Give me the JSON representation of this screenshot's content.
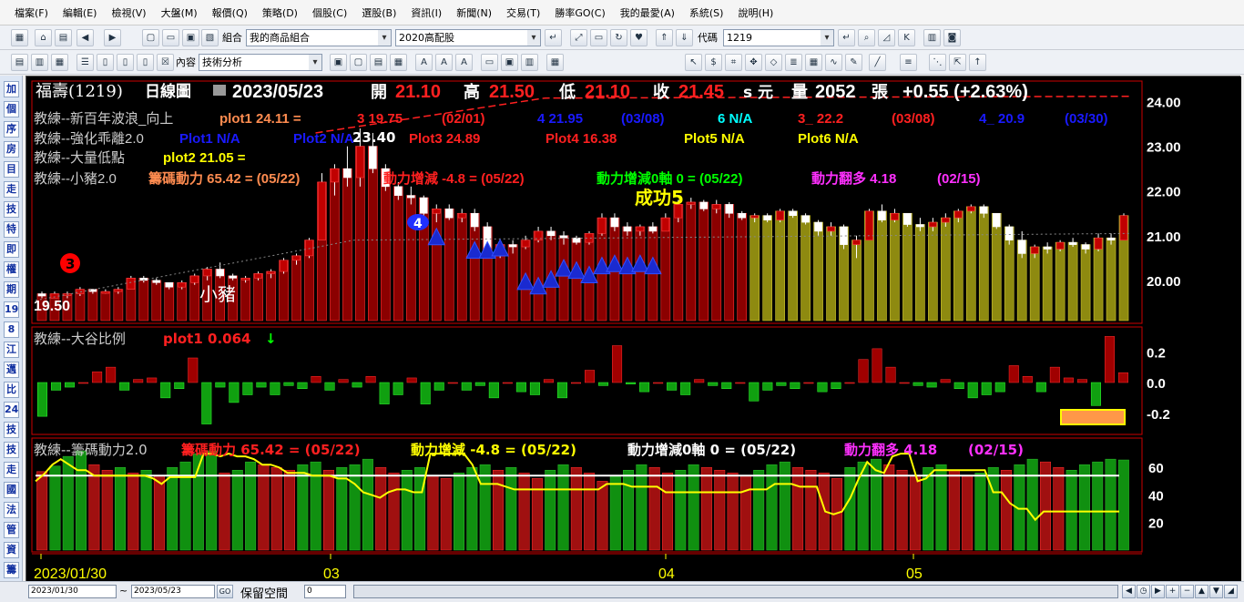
{
  "menu": [
    "檔案(F)",
    "編輯(E)",
    "檢視(V)",
    "大盤(M)",
    "報價(Q)",
    "策略(D)",
    "個股(C)",
    "選股(B)",
    "資訊(I)",
    "新聞(N)",
    "交易(T)",
    "勝率GO(C)",
    "我的最愛(A)",
    "系統(S)",
    "說明(H)"
  ],
  "toolbar1": {
    "group_label": "組合",
    "group_value": "我的商品組合",
    "preset_value": "2020高配股",
    "code_label": "代碼",
    "code_value": "1219"
  },
  "toolbar2": {
    "content_label": "內容",
    "content_value": "技術分析"
  },
  "sidebar": [
    "加",
    "個",
    "序",
    "房",
    "目",
    "走",
    "技",
    "特",
    "即",
    "權",
    "期",
    "19",
    "8",
    "江",
    "邁",
    "比",
    "24",
    "技",
    "技",
    "走",
    "國",
    "法",
    "管",
    "資",
    "籌"
  ],
  "header": {
    "name": "福壽(1219)",
    "period": "日線圖",
    "date": "2023/05/23",
    "open_label": "開",
    "open": "21.10",
    "high_label": "高",
    "high": "21.50",
    "low_label": "低",
    "low": "21.10",
    "close_label": "收",
    "close": "21.45",
    "unit": "s 元",
    "vol_label": "量",
    "vol": "2052",
    "vol_unit": "張",
    "change": "+0.55 (+2.63%)"
  },
  "colors": {
    "red": "#ff2020",
    "yellow": "#ffff00",
    "blue": "#1a1aff",
    "green": "#00ff00",
    "magenta": "#ff30ff",
    "orange": "#ff8c50",
    "white": "#ffffff",
    "cyan": "#00ffff",
    "candle_red": "#8b0000",
    "candle_olive": "#8e8a10",
    "bar_green": "#109010"
  },
  "panel1": {
    "line1": {
      "name": "教練--新百年波浪_向上",
      "p1": "plot1 24.11 =",
      "p2": "3 19.75",
      "p3": "(02/01)",
      "p4": "4 21.95",
      "p5": "(03/08)",
      "p6": "6 N/A",
      "p7": "3_ 22.2",
      "p8": "(03/08)",
      "p9": "4_ 20.9",
      "p10": "(03/30)"
    },
    "line2": {
      "name": "教練--強化乖離2.0",
      "p1": "Plot1 N/A",
      "p2": "Plot2 N/A",
      "p3": "Plot3 24.89",
      "p4": "Plot4 16.38",
      "p5": "Plot5 N/A",
      "p6": "Plot6 N/A"
    },
    "line3": {
      "name": "教練--大量低點",
      "p1": "plot2 21.05 ="
    },
    "line4": {
      "name": "教練--小豬2.0",
      "p1": "籌碼動力 65.42 = (05/22)",
      "p2": "動力增減 -4.8 = (05/22)",
      "p3": "動力增減0軸 0 = (05/22)",
      "p4": "動力翻多 4.18",
      "p5": "(02/15)"
    },
    "labels": {
      "start_price": "19.50",
      "pig": "小豬",
      "success": "成功5",
      "n3": "3",
      "n4": "4",
      "peak": "23.40"
    },
    "yticks": [
      "24.00",
      "23.00",
      "22.00",
      "21.00",
      "20.00"
    ]
  },
  "panel2": {
    "name": "教練--大谷比例",
    "p1": "plot1 0.064",
    "yticks": [
      "0.2",
      "0.0",
      "-0.2"
    ]
  },
  "panel3": {
    "name": "教練--籌碼動力2.0",
    "p1": "籌碼動力 65.42 = (05/22)",
    "p2": "動力增減 -4.8 = (05/22)",
    "p3": "動力增減0軸 0 = (05/22)",
    "p4": "動力翻多 4.18",
    "p5": "(02/15)",
    "yticks": [
      "60",
      "40",
      "20"
    ]
  },
  "xaxis": [
    "2023/01/30",
    "03",
    "04",
    "05"
  ],
  "bottom": {
    "from": "2023/01/30",
    "sep": "~",
    "to": "2023/05/23",
    "go": "GO",
    "space_label": "保留空間",
    "space_value": "0"
  },
  "chart_data": {
    "type": "bar",
    "title": "福壽(1219) 日線圖",
    "candles": [
      [
        19.7,
        19.75,
        19.6,
        19.65
      ],
      [
        19.6,
        19.75,
        19.6,
        19.7
      ],
      [
        19.7,
        19.75,
        19.6,
        19.7
      ],
      [
        19.7,
        19.85,
        19.65,
        19.8
      ],
      [
        19.8,
        19.8,
        19.7,
        19.75
      ],
      [
        19.75,
        19.8,
        19.7,
        19.75
      ],
      [
        19.75,
        19.85,
        19.7,
        19.8
      ],
      [
        19.8,
        20.1,
        19.8,
        20.05
      ],
      [
        20.05,
        20.1,
        19.95,
        20.0
      ],
      [
        20.0,
        20.05,
        19.9,
        19.95
      ],
      [
        19.95,
        19.95,
        19.8,
        19.85
      ],
      [
        19.85,
        20.0,
        19.8,
        19.95
      ],
      [
        19.95,
        20.15,
        19.9,
        20.1
      ],
      [
        20.1,
        20.3,
        20.0,
        20.25
      ],
      [
        20.25,
        20.4,
        20.05,
        20.1
      ],
      [
        20.1,
        20.15,
        20.0,
        20.05
      ],
      [
        20.05,
        20.1,
        19.95,
        20.05
      ],
      [
        20.05,
        20.2,
        20.0,
        20.15
      ],
      [
        20.15,
        20.25,
        20.05,
        20.2
      ],
      [
        20.2,
        20.5,
        20.15,
        20.45
      ],
      [
        20.45,
        20.6,
        20.35,
        20.55
      ],
      [
        20.55,
        20.95,
        20.5,
        20.9
      ],
      [
        20.9,
        22.4,
        20.9,
        22.2
      ],
      [
        22.2,
        22.6,
        21.9,
        22.5
      ],
      [
        22.5,
        23.0,
        22.1,
        22.3
      ],
      [
        22.3,
        23.4,
        22.1,
        23.0
      ],
      [
        23.0,
        23.3,
        22.4,
        22.5
      ],
      [
        22.5,
        22.6,
        22.0,
        22.1
      ],
      [
        22.1,
        22.2,
        21.8,
        21.9
      ],
      [
        21.9,
        22.1,
        21.7,
        21.85
      ],
      [
        21.85,
        21.9,
        21.4,
        21.5
      ],
      [
        21.5,
        21.7,
        21.3,
        21.6
      ],
      [
        21.6,
        21.7,
        21.35,
        21.4
      ],
      [
        21.4,
        21.6,
        21.3,
        21.5
      ],
      [
        21.5,
        21.6,
        21.1,
        21.2
      ],
      [
        21.2,
        21.3,
        20.6,
        20.7
      ],
      [
        20.7,
        20.9,
        20.5,
        20.8
      ],
      [
        20.8,
        20.9,
        20.6,
        20.75
      ],
      [
        20.75,
        21.0,
        20.7,
        20.9
      ],
      [
        20.9,
        21.2,
        20.85,
        21.1
      ],
      [
        21.1,
        21.2,
        20.9,
        21.0
      ],
      [
        21.0,
        21.1,
        20.8,
        20.95
      ],
      [
        20.95,
        21.0,
        20.8,
        20.85
      ],
      [
        20.85,
        21.1,
        20.8,
        21.05
      ],
      [
        21.05,
        21.5,
        21.0,
        21.4
      ],
      [
        21.4,
        21.5,
        21.1,
        21.2
      ],
      [
        21.2,
        21.3,
        21.0,
        21.1
      ],
      [
        21.1,
        21.25,
        21.0,
        21.2
      ],
      [
        21.2,
        21.3,
        21.05,
        21.1
      ],
      [
        21.1,
        21.5,
        21.1,
        21.4
      ],
      [
        21.4,
        21.8,
        21.3,
        21.7
      ],
      [
        21.7,
        21.85,
        21.6,
        21.75
      ],
      [
        21.75,
        21.8,
        21.55,
        21.6
      ],
      [
        21.6,
        21.8,
        21.5,
        21.7
      ],
      [
        21.7,
        21.75,
        21.4,
        21.5
      ],
      [
        21.5,
        21.55,
        21.35,
        21.4
      ],
      [
        21.4,
        21.5,
        21.3,
        21.45
      ],
      [
        21.45,
        21.5,
        21.3,
        21.35
      ],
      [
        21.35,
        21.6,
        21.3,
        21.55
      ],
      [
        21.55,
        21.6,
        21.4,
        21.45
      ],
      [
        21.45,
        21.5,
        21.25,
        21.3
      ],
      [
        21.3,
        21.35,
        21.0,
        21.1
      ],
      [
        21.1,
        21.3,
        21.0,
        21.2
      ],
      [
        21.2,
        21.25,
        20.7,
        20.8
      ],
      [
        20.8,
        21.0,
        20.5,
        20.9
      ],
      [
        20.9,
        21.6,
        20.9,
        21.55
      ],
      [
        21.55,
        21.7,
        21.3,
        21.35
      ],
      [
        21.35,
        21.6,
        21.3,
        21.5
      ],
      [
        21.5,
        21.5,
        21.2,
        21.25
      ],
      [
        21.25,
        21.4,
        21.1,
        21.2
      ],
      [
        21.2,
        21.4,
        21.1,
        21.3
      ],
      [
        21.3,
        21.5,
        21.2,
        21.4
      ],
      [
        21.4,
        21.6,
        21.3,
        21.55
      ],
      [
        21.55,
        21.7,
        21.5,
        21.65
      ],
      [
        21.65,
        21.7,
        21.4,
        21.5
      ],
      [
        21.5,
        21.5,
        21.15,
        21.2
      ],
      [
        21.2,
        21.25,
        20.8,
        20.9
      ],
      [
        20.9,
        21.1,
        20.5,
        20.6
      ],
      [
        20.6,
        20.8,
        20.5,
        20.75
      ],
      [
        20.75,
        20.85,
        20.6,
        20.7
      ],
      [
        20.7,
        20.9,
        20.65,
        20.85
      ],
      [
        20.85,
        20.95,
        20.75,
        20.8
      ],
      [
        20.8,
        20.85,
        20.6,
        20.7
      ],
      [
        20.7,
        21.05,
        20.65,
        20.95
      ],
      [
        20.95,
        21.05,
        20.8,
        20.9
      ],
      [
        20.9,
        21.5,
        20.9,
        21.45
      ]
    ],
    "ratio": [
      -0.22,
      -0.05,
      -0.03,
      0.0,
      0.07,
      0.1,
      -0.05,
      0.02,
      0.03,
      -0.1,
      -0.04,
      0.16,
      -0.27,
      -0.03,
      -0.13,
      -0.08,
      -0.03,
      -0.08,
      -0.02,
      -0.04,
      0.04,
      -0.05,
      0.02,
      -0.03,
      0.04,
      -0.14,
      -0.08,
      0.03,
      -0.14,
      -0.05,
      0.0,
      -0.05,
      -0.02,
      -0.1,
      0.0,
      -0.06,
      -0.08,
      0.02,
      -0.1,
      0.0,
      0.08,
      -0.02,
      0.24,
      -0.01,
      -0.06,
      0.0,
      -0.05,
      -0.08,
      0.02,
      -0.02,
      -0.04,
      0.0,
      -0.12,
      -0.05,
      -0.02,
      -0.04,
      0.0,
      -0.06,
      -0.04,
      0.0,
      0.15,
      0.22,
      0.1,
      0.0,
      -0.02,
      -0.03,
      0.02,
      -0.04,
      -0.1,
      -0.08,
      -0.06,
      0.11,
      0.04,
      -0.06,
      0.1,
      0.03,
      0.02,
      -0.15,
      0.3,
      0.064
    ],
    "chip": [
      57,
      61,
      68,
      72,
      62,
      58,
      60,
      56,
      58,
      54,
      60,
      64,
      70,
      72,
      56,
      58,
      64,
      62,
      60,
      58,
      62,
      64,
      58,
      60,
      62,
      66,
      60,
      56,
      58,
      60,
      54,
      52,
      56,
      60,
      62,
      58,
      60,
      56,
      52,
      58,
      62,
      60,
      56,
      50,
      54,
      58,
      62,
      60,
      56,
      58,
      62,
      60,
      58,
      56,
      54,
      58,
      62,
      64,
      60,
      58,
      56,
      52,
      60,
      64,
      66,
      62,
      58,
      54,
      60,
      62,
      58,
      54,
      56,
      60,
      58,
      62,
      66,
      64,
      60,
      58,
      62,
      64,
      66,
      65.42
    ],
    "chip_up": [
      0,
      1,
      1,
      1,
      0,
      0,
      1,
      0,
      1,
      0,
      1,
      1,
      1,
      1,
      0,
      1,
      1,
      0,
      0,
      0,
      1,
      1,
      0,
      1,
      1,
      1,
      0,
      0,
      1,
      1,
      0,
      0,
      1,
      1,
      1,
      0,
      1,
      0,
      0,
      1,
      1,
      0,
      0,
      0,
      1,
      1,
      1,
      0,
      0,
      1,
      1,
      0,
      0,
      0,
      0,
      1,
      1,
      1,
      0,
      0,
      0,
      0,
      1,
      1,
      1,
      0,
      0,
      0,
      1,
      1,
      0,
      0,
      1,
      1,
      0,
      1,
      1,
      0,
      0,
      1,
      1,
      1,
      1,
      1
    ],
    "momentum": [
      50,
      55,
      62,
      66,
      62,
      58,
      58,
      54,
      54,
      54,
      54,
      54,
      54,
      54,
      52,
      48,
      53,
      53,
      53,
      53,
      70,
      70,
      68,
      70,
      68,
      68,
      66,
      62,
      62,
      60,
      56,
      56,
      56,
      54,
      54,
      54,
      52,
      52,
      48,
      42,
      40,
      38,
      42,
      44,
      44,
      42,
      42,
      70,
      70,
      70,
      70,
      70,
      62,
      48,
      48,
      48,
      46,
      44,
      44,
      44,
      44,
      44,
      44,
      44,
      44,
      44,
      44,
      44,
      48,
      48,
      48,
      46,
      46,
      46,
      46,
      42,
      42,
      42,
      42,
      42,
      42,
      42,
      42,
      42,
      42,
      44,
      44,
      44,
      48,
      48,
      48,
      46,
      46,
      46,
      28,
      26,
      28,
      38,
      52,
      64,
      58,
      56,
      68,
      70,
      70,
      50,
      52,
      58,
      58,
      58,
      58,
      58,
      58,
      58,
      42,
      42,
      34,
      30,
      30,
      22,
      28,
      28,
      28,
      28,
      28,
      28,
      28,
      28,
      28,
      28
    ],
    "ylim_price": [
      19.1,
      24.4
    ],
    "ylim_ratio": [
      -0.32,
      0.32
    ],
    "ylim_chip": [
      0,
      78
    ]
  }
}
